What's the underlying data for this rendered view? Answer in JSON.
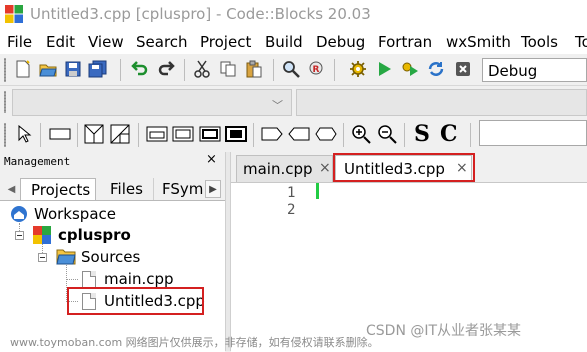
{
  "window": {
    "title": "Untitled3.cpp [cpluspro] - Code::Blocks 20.03"
  },
  "menu": [
    {
      "label": "File"
    },
    {
      "label": "Edit"
    },
    {
      "label": "View"
    },
    {
      "label": "Search"
    },
    {
      "label": "Project"
    },
    {
      "label": "Build"
    },
    {
      "label": "Debug"
    },
    {
      "label": "Fortran"
    },
    {
      "label": "wxSmith"
    },
    {
      "label": "Tools"
    },
    {
      "label": "To"
    }
  ],
  "toolbar": {
    "build_target": "Debug",
    "main_icons": [
      "new-file-icon",
      "open-icon",
      "save-icon",
      "save-all-icon",
      "undo-icon",
      "redo-icon",
      "cut-icon",
      "copy-icon",
      "paste-icon",
      "find-icon",
      "replace-icon",
      "build-gear-icon",
      "run-icon",
      "build-run-icon",
      "rebuild-icon",
      "abort-icon"
    ],
    "edit_icons": [
      "pointer-icon",
      "rectangle-icon",
      "decision-icon",
      "parallelogram-icon",
      "block-icon",
      "break-icon",
      "frame-icon",
      "stop-icon",
      "left-arrow-shape-icon",
      "right-arrow-shape-icon",
      "both-arrow-shape-icon",
      "zoom-in-icon",
      "zoom-out-icon"
    ],
    "s_label": "S",
    "c_label": "C"
  },
  "management": {
    "title": "Management",
    "close": "×",
    "tabs": [
      {
        "label": "Projects",
        "active": true
      },
      {
        "label": "Files",
        "active": false
      },
      {
        "label": "FSym",
        "active": false
      }
    ],
    "nav_left": "◀",
    "nav_right": "▶",
    "tree": {
      "workspace": "Workspace",
      "project": "cpluspro",
      "folder": "Sources",
      "files": [
        "main.cpp",
        "Untitled3.cpp"
      ]
    }
  },
  "editor": {
    "tabs": [
      {
        "label": "main.cpp",
        "close": "×",
        "active": false
      },
      {
        "label": "Untitled3.cpp",
        "close": "×",
        "active": true
      }
    ],
    "line_numbers": [
      "1",
      "2"
    ]
  },
  "watermark": {
    "bottom": "www.toymoban.com 网络图片仅供展示，非存储，如有侵权请联系删除。",
    "csdn": "CSDN @IT从业者张某某"
  },
  "colors": {
    "highlight": "#d42020",
    "change_bar": "#22cc44"
  }
}
